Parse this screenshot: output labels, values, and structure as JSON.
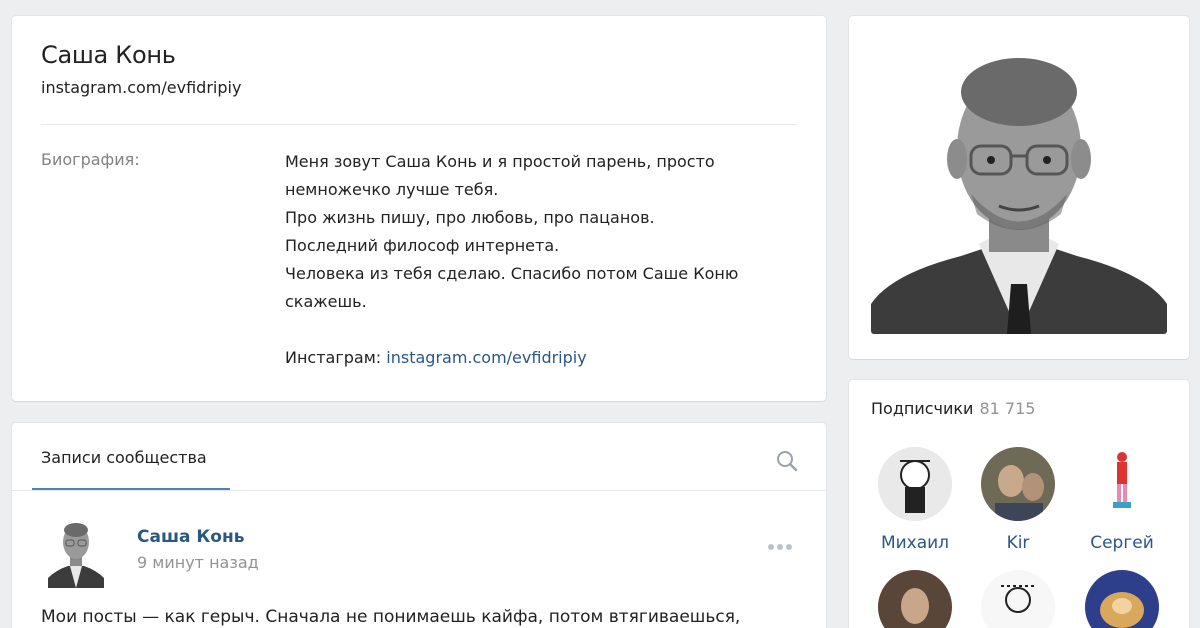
{
  "profile": {
    "name": "Саша Конь",
    "status_link": "instagram.com/evfidripiy",
    "bio_label": "Биография:",
    "bio_lines": [
      "Меня зовут Саша Конь и я простой парень, просто",
      "немножечко лучше тебя.",
      "Про жизнь пишу, про любовь, про пацанов.",
      "Последний философ интернета.",
      "Человека из тебя сделаю. Спасибо потом Саше Коню",
      "скажешь."
    ],
    "instagram_label": "Инстаграм:",
    "instagram_link": "instagram.com/evfidripiy"
  },
  "followers": {
    "title": "Подписчики",
    "count": "81 715",
    "items": [
      {
        "name": "Михаил"
      },
      {
        "name": "Kir"
      },
      {
        "name": "Сергей"
      }
    ]
  },
  "wall": {
    "tab_label": "Записи сообщества",
    "post": {
      "author": "Саша Конь",
      "time": "9 минут назад",
      "text": "Мои посты — как герыч. Сначала не понимаешь кайфа, потом втягиваешься,"
    }
  },
  "colors": {
    "link": "#2a5885",
    "accent": "#5181b8",
    "background": "#edeef0"
  }
}
